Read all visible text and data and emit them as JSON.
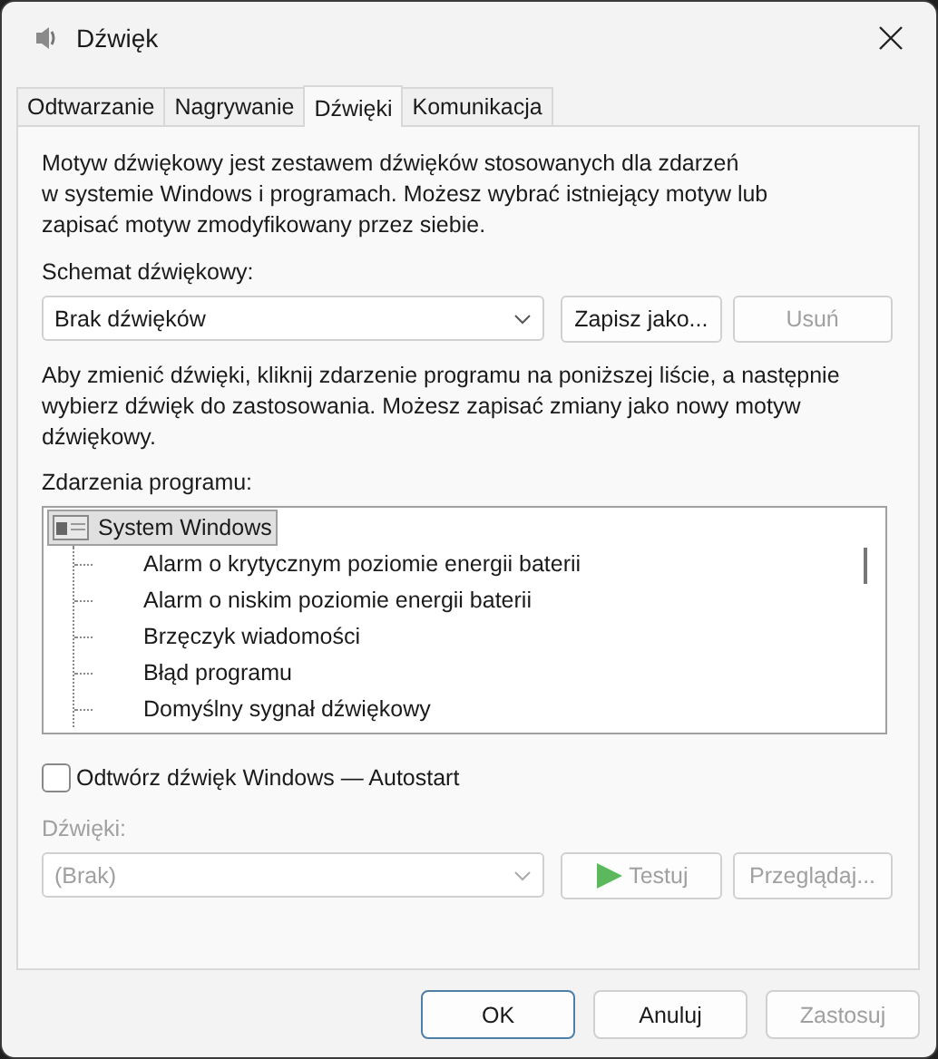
{
  "window": {
    "title": "Dźwięk"
  },
  "tabs": [
    {
      "label": "Odtwarzanie",
      "selected": false
    },
    {
      "label": "Nagrywanie",
      "selected": false
    },
    {
      "label": "Dźwięki",
      "selected": true
    },
    {
      "label": "Komunikacja",
      "selected": false
    }
  ],
  "description": [
    "Motyw dźwiękowy jest zestawem dźwięków stosowanych dla zdarzeń",
    "w systemie Windows i programach. Możesz wybrać istniejący motyw lub",
    "zapisać motyw zmodyfikowany przez siebie."
  ],
  "scheme": {
    "label": "Schemat dźwiękowy:",
    "value": "Brak dźwięków"
  },
  "scheme_buttons": [
    {
      "label": "Zapisz jako...",
      "disabled": false
    },
    {
      "label": "Usuń",
      "disabled": true
    }
  ],
  "instructions": [
    "Aby zmienić dźwięki, kliknij zdarzenie programu na poniższej liście, a następnie",
    "wybierz dźwięk do zastosowania. Możesz zapisać zmiany jako nowy motyw",
    "dźwiękowy."
  ],
  "events": {
    "label": "Zdarzenia programu:",
    "tree": [
      {
        "label": "System Windows",
        "selected": true,
        "children": [
          {
            "label": "Alarm o krytycznym poziomie energii baterii",
            "selected": false
          },
          {
            "label": "Alarm o niskim poziomie energii baterii",
            "selected": false
          },
          {
            "label": "Brzęczyk wiadomości",
            "selected": false
          },
          {
            "label": "Błąd programu",
            "selected": false
          },
          {
            "label": "Domyślny sygnał dźwiękowy",
            "selected": false
          }
        ]
      }
    ]
  },
  "autostart": {
    "label": "Odtwórz dźwięk Windows — Autostart",
    "checked": false
  },
  "sound": {
    "label": "Dźwięki:",
    "value": "(Brak)",
    "disabled": true
  },
  "sound_buttons": [
    {
      "kind": "play",
      "label": "Testuj",
      "disabled": true
    },
    {
      "kind": "plain",
      "label": "Przeglądaj...",
      "disabled": true
    }
  ],
  "footer_buttons": [
    {
      "label": "OK",
      "default": true,
      "disabled": false
    },
    {
      "label": "Anuluj",
      "default": false,
      "disabled": false
    },
    {
      "label": "Zastosuj",
      "default": false,
      "disabled": true
    }
  ]
}
